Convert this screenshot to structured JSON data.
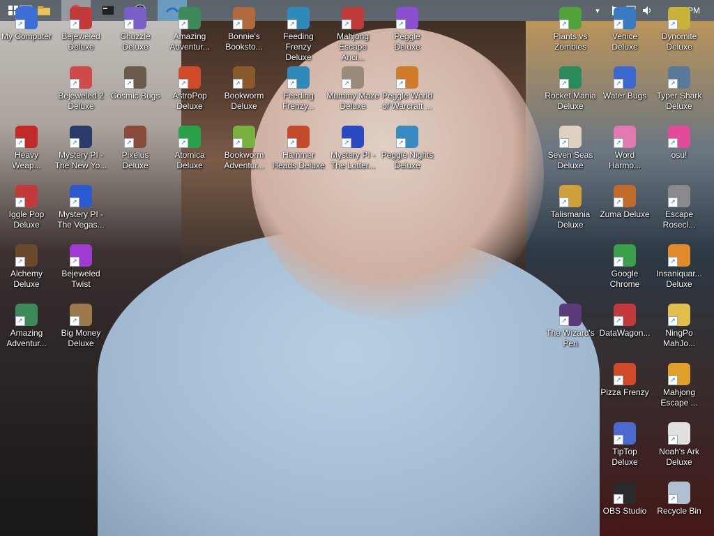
{
  "taskbar": {
    "clock": "5:07 PM",
    "apps": [
      "windows-flag-icon",
      "file-explorer-icon",
      "chrome-icon",
      "terminal-icon",
      "obs-icon",
      "water-app-icon"
    ]
  },
  "desktop": {
    "icons": [
      {
        "label": "My Computer",
        "color": "#3b6fd6"
      },
      {
        "label": "Bejeweled Deluxe",
        "color": "#c23b3b"
      },
      {
        "label": "Chuzzle Deluxe",
        "color": "#7a5fc9"
      },
      {
        "label": "Amazing Adventur...",
        "color": "#3c8a5a"
      },
      {
        "label": "Bonnie's Booksto...",
        "color": "#b06a3c"
      },
      {
        "label": "Feeding Frenzy Deluxe",
        "color": "#2e8ab8"
      },
      {
        "label": "Mahjong Escape Anci...",
        "color": "#c23b3b"
      },
      {
        "label": "Peggle Deluxe",
        "color": "#8a4fd0"
      },
      {
        "label": "Plants vs Zombies",
        "color": "#4fa33a"
      },
      {
        "label": "Venice Deluxe",
        "color": "#3a7ac2"
      },
      {
        "label": "Dynomite Deluxe",
        "color": "#c9b23a"
      },
      {
        "label": "Bejeweled 2 Deluxe",
        "color": "#d04a4a"
      },
      {
        "label": "Cosmic Bugs",
        "color": "#6a5a4a"
      },
      {
        "label": "AstroPop Deluxe",
        "color": "#d04a2a"
      },
      {
        "label": "Bookworm Deluxe",
        "color": "#8a5a2a"
      },
      {
        "label": "Feeding Frenzy...",
        "color": "#2e8ab8"
      },
      {
        "label": "Mummy Maze Deluxe",
        "color": "#9a8a7a"
      },
      {
        "label": "Peggle World of Warcraft ...",
        "color": "#d07a2a"
      },
      {
        "label": "Rocket Mania Deluxe",
        "color": "#2a8a5a"
      },
      {
        "label": "Water Bugs",
        "color": "#3a6ad0"
      },
      {
        "label": "Typer Shark Deluxe",
        "color": "#5a7a9a"
      },
      {
        "label": "Heavy Weap...",
        "color": "#c22a2a"
      },
      {
        "label": "Mystery PI - The New Yo...",
        "color": "#2a3a6a"
      },
      {
        "label": "Pixelus Deluxe",
        "color": "#8a4a3a"
      },
      {
        "label": "Atomica Deluxe",
        "color": "#2aa04a"
      },
      {
        "label": "Bookworm Adventur...",
        "color": "#7ab040"
      },
      {
        "label": "Hammer Heads Deluxe",
        "color": "#c24a2a"
      },
      {
        "label": "Mystery PI - The Lotter...",
        "color": "#2a4ac2"
      },
      {
        "label": "Peggle Nights Deluxe",
        "color": "#3a8ac2"
      },
      {
        "label": "Seven Seas Deluxe",
        "color": "#e0d0c0"
      },
      {
        "label": "Word Harmo...",
        "color": "#e07ab0"
      },
      {
        "label": "osu!",
        "color": "#e24a9a"
      },
      {
        "label": "Iggle Pop Deluxe",
        "color": "#c23a3a"
      },
      {
        "label": "Mystery PI - The Vegas...",
        "color": "#2a5ad0"
      },
      {
        "label": "Talismania Deluxe",
        "color": "#d0a03a"
      },
      {
        "label": "Zuma Deluxe",
        "color": "#c26a2a"
      },
      {
        "label": "Escape Rosecl...",
        "color": "#8a8a8a"
      },
      {
        "label": "Alchemy Deluxe",
        "color": "#6a4a2a"
      },
      {
        "label": "Bejeweled Twist",
        "color": "#a03ad0"
      },
      {
        "label": "Google Chrome",
        "color": "#3aa04a"
      },
      {
        "label": "Insaniquar... Deluxe",
        "color": "#e08a2a"
      },
      {
        "label": "Amazing Adventur...",
        "color": "#3c8a5a"
      },
      {
        "label": "Big Money Deluxe",
        "color": "#9a7a4a"
      },
      {
        "label": "The Wizard's Pen",
        "color": "#5a3a7a"
      },
      {
        "label": "DataWagon...",
        "color": "#c23a3a"
      },
      {
        "label": "NingPo MahJo...",
        "color": "#e0c04a"
      },
      {
        "label": "Pizza Frenzy",
        "color": "#d04a2a"
      },
      {
        "label": "Mahjong Escape ...",
        "color": "#e0a02a"
      },
      {
        "label": "TipTop Deluxe",
        "color": "#4a6ad0"
      },
      {
        "label": "Noah's Ark Deluxe",
        "color": "#e0e0e0"
      },
      {
        "label": "OBS Studio",
        "color": "#2a2a2a"
      },
      {
        "label": "Recycle Bin",
        "color": "#b0c0d0"
      }
    ]
  }
}
